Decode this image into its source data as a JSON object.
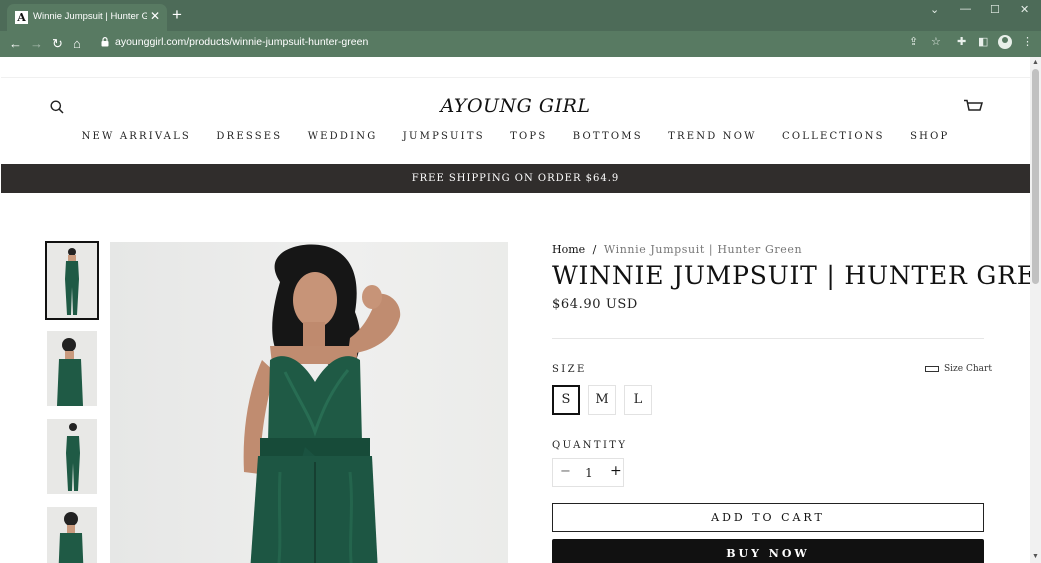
{
  "browser": {
    "tab_title": "Winnie Jumpsuit | Hunter Green",
    "tab_favicon_letter": "A",
    "url": "ayounggirl.com/products/winnie-jumpsuit-hunter-green",
    "theme_color": "#587a62"
  },
  "header": {
    "logo": "AYOUNG GIRL",
    "nav": [
      "NEW ARRIVALS",
      "DRESSES",
      "WEDDING",
      "JUMPSUITS",
      "TOPS",
      "BOTTOMS",
      "TREND NOW",
      "COLLECTIONS",
      "SHOP"
    ]
  },
  "announcement": "FREE SHIPPING ON ORDER $64.9",
  "product": {
    "breadcrumb_home": "Home",
    "breadcrumb_sep": "/",
    "breadcrumb_current": "Winnie Jumpsuit | Hunter Green",
    "title": "WINNIE JUMPSUIT | HUNTER GREEN",
    "price": "$64.90 USD",
    "size_label": "SIZE",
    "size_chart_label": "Size Chart",
    "sizes": [
      "S",
      "M",
      "L"
    ],
    "selected_size": "S",
    "quantity_label": "QUANTITY",
    "quantity": "1",
    "minus": "−",
    "plus": "+",
    "add_to_cart": "ADD TO CART",
    "buy_now": "BUY NOW",
    "product_color": "#1f5a45"
  }
}
